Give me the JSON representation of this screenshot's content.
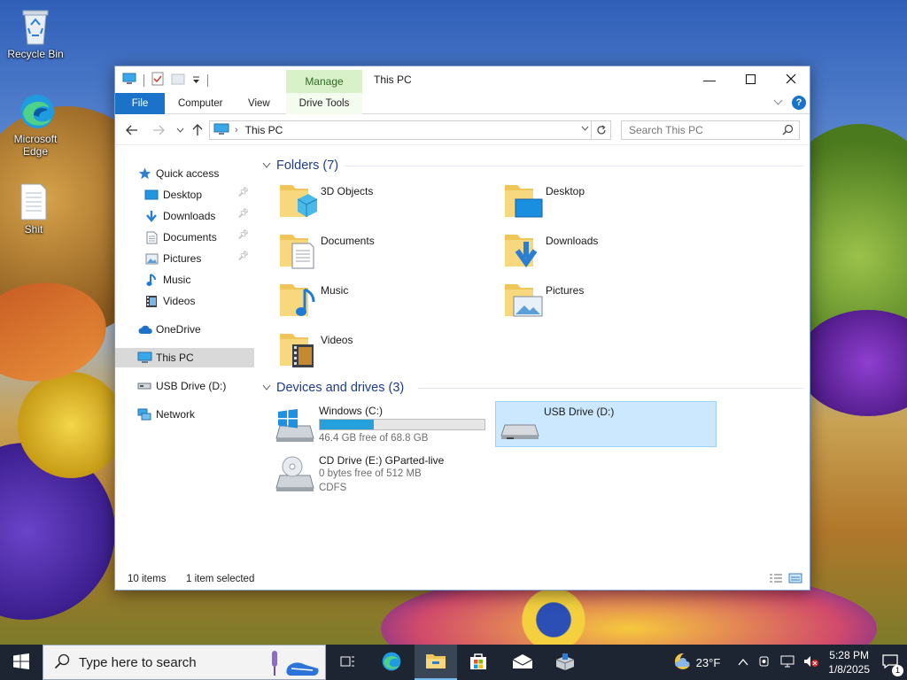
{
  "desktop": {
    "icons": [
      {
        "label": "Recycle Bin",
        "icon": "recycle-bin-icon"
      },
      {
        "label": "Microsoft Edge",
        "icon": "edge-icon"
      },
      {
        "label": "Shit",
        "icon": "text-file-icon"
      }
    ]
  },
  "window": {
    "title": "This PC",
    "manage_tab": "Manage",
    "ribbon_tabs": [
      "File",
      "Computer",
      "View",
      "Drive Tools"
    ],
    "address": {
      "path": "This PC"
    },
    "search": {
      "placeholder": "Search This PC"
    },
    "nav": {
      "quick_access": "Quick access",
      "items": [
        {
          "label": "Desktop",
          "pinned": true
        },
        {
          "label": "Downloads",
          "pinned": true
        },
        {
          "label": "Documents",
          "pinned": true
        },
        {
          "label": "Pictures",
          "pinned": true
        },
        {
          "label": "Music",
          "pinned": false
        },
        {
          "label": "Videos",
          "pinned": false
        }
      ],
      "onedrive": "OneDrive",
      "this_pc": "This PC",
      "usb": "USB Drive (D:)",
      "network": "Network"
    },
    "folders": {
      "header": "Folders (7)",
      "items": [
        "3D Objects",
        "Desktop",
        "Documents",
        "Downloads",
        "Music",
        "Pictures",
        "Videos"
      ]
    },
    "drives": {
      "header": "Devices and drives (3)",
      "items": [
        {
          "name": "Windows (C:)",
          "free": "46.4 GB free of 68.8 GB",
          "used_fraction": 0.33
        },
        {
          "name": "USB Drive (D:)",
          "selected": true
        },
        {
          "name": "CD Drive (E:) GParted-live",
          "free": "0 bytes free of 512 MB",
          "fs": "CDFS"
        }
      ]
    },
    "status": {
      "items": "10 items",
      "selected": "1 item selected"
    }
  },
  "taskbar": {
    "search_placeholder": "Type here to search",
    "weather": {
      "temp": "23°F"
    },
    "clock": {
      "time": "5:28 PM",
      "date": "1/8/2025"
    },
    "notification_count": "1",
    "colors": {
      "bg": "#1c2531",
      "accent": "#76b9ed"
    }
  },
  "colors": {
    "file_tab": "#1a73c9",
    "manage_tab": "#d9f1c9",
    "group_header": "#1e3c8c",
    "selection": "#cce8ff",
    "drive_bar": "#26a0da"
  }
}
